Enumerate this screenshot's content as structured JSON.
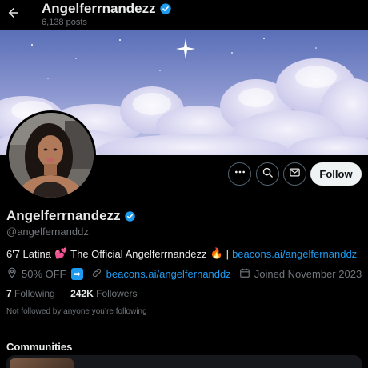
{
  "header": {
    "display_name": "Angelferrnandezz",
    "post_count": "6,138 posts"
  },
  "profile": {
    "display_name": "Angelferrnandezz",
    "handle": "@angelfernanddz",
    "bio_prefix": "6'7 Latina",
    "bio_middle": "The Official Angelferrnandezz",
    "bio_separator": "|",
    "bio_link": "beacons.ai/angelfernanddz",
    "location": "50% OFF",
    "website": "beacons.ai/angelfernanddz",
    "joined": "Joined November 2023",
    "following_count": "7",
    "following_label": "Following",
    "followers_count": "242K",
    "followers_label": "Followers",
    "not_followed_text": "Not followed by anyone you’re following"
  },
  "actions": {
    "follow_label": "Follow"
  },
  "communities": {
    "heading": "Communities"
  },
  "icons": {
    "back": "arrow-left-icon",
    "verified": "verified-badge-icon",
    "more": "more-icon",
    "search": "search-icon",
    "message": "envelope-icon",
    "location": "location-pin-icon",
    "link": "link-icon",
    "calendar": "calendar-icon"
  },
  "colors": {
    "accent": "#1d9bf0",
    "background": "#000000",
    "secondary_text": "#71767b"
  }
}
